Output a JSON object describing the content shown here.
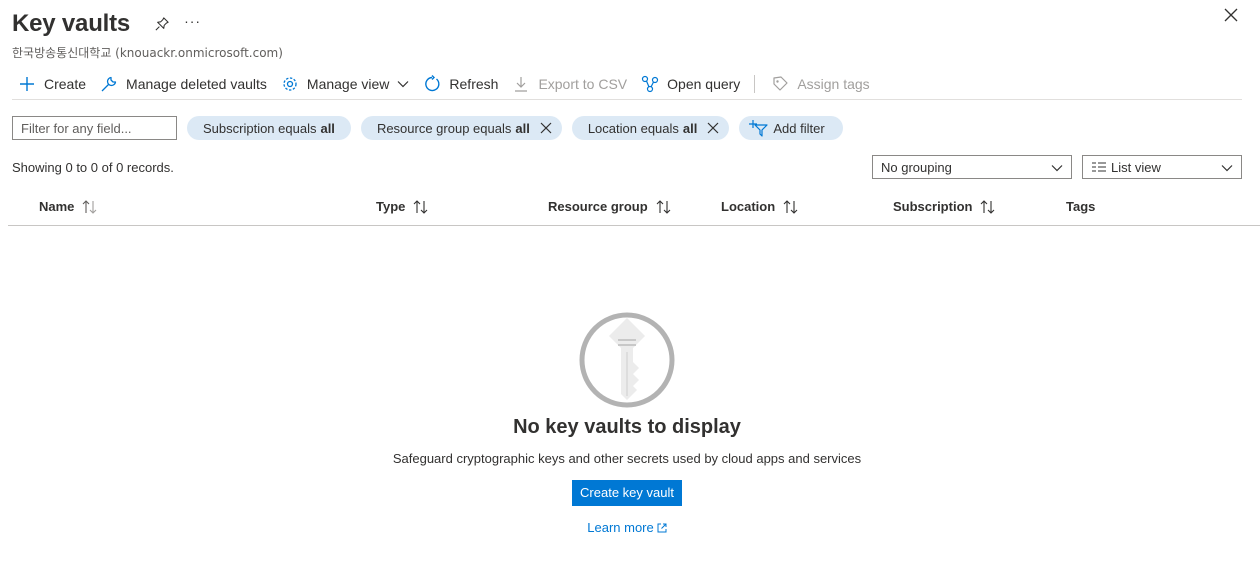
{
  "header": {
    "title": "Key vaults",
    "subtitle": "한국방송통신대학교 (knouackr.onmicrosoft.com)",
    "more_label": "···"
  },
  "toolbar": {
    "create": "Create",
    "manage_deleted": "Manage deleted vaults",
    "manage_view": "Manage view",
    "refresh": "Refresh",
    "export_csv": "Export to CSV",
    "open_query": "Open query",
    "assign_tags": "Assign tags"
  },
  "filters": {
    "placeholder": "Filter for any field...",
    "pills": [
      {
        "label": "Subscription equals",
        "value": "all"
      },
      {
        "label": "Resource group equals",
        "value": "all"
      },
      {
        "label": "Location equals",
        "value": "all"
      }
    ],
    "add_filter": "Add filter"
  },
  "records_text": "Showing 0 to 0 of 0 records.",
  "grouping": {
    "selected": "No grouping"
  },
  "view": {
    "selected": "List view"
  },
  "table": {
    "columns": [
      "Name",
      "Type",
      "Resource group",
      "Location",
      "Subscription",
      "Tags"
    ]
  },
  "empty_state": {
    "title": "No key vaults to display",
    "description": "Safeguard cryptographic keys and other secrets used by cloud apps and services",
    "cta": "Create key vault",
    "learn_more": "Learn more"
  },
  "colors": {
    "accent": "#0078d4",
    "pill_bg": "#dce9f5",
    "text": "#323130",
    "disabled": "#a19f9d"
  }
}
